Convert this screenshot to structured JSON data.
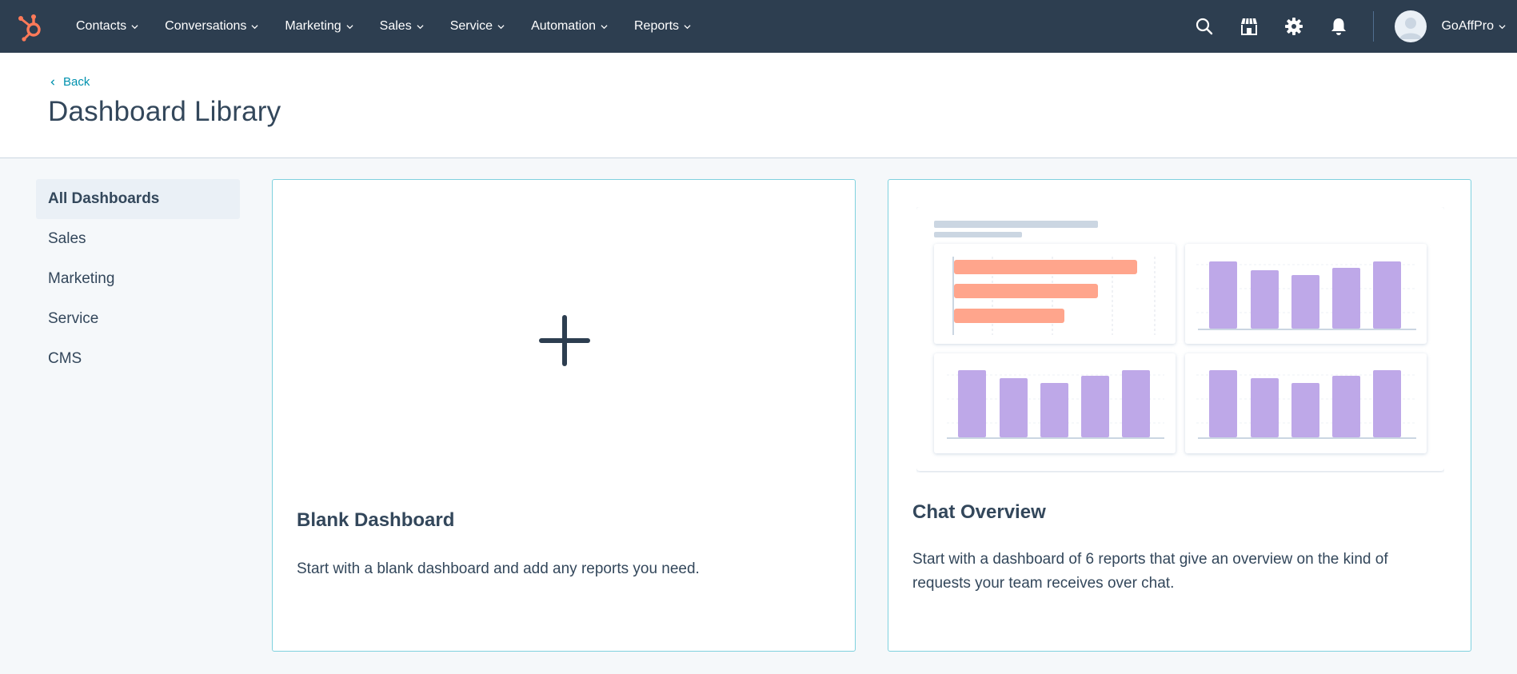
{
  "nav": {
    "items": [
      {
        "label": "Contacts"
      },
      {
        "label": "Conversations"
      },
      {
        "label": "Marketing"
      },
      {
        "label": "Sales"
      },
      {
        "label": "Service"
      },
      {
        "label": "Automation"
      },
      {
        "label": "Reports"
      }
    ],
    "account_name": "GoAffPro",
    "brand_color": "#ff7a59",
    "bar_color": "#2d3e50",
    "icons": [
      "search-icon",
      "marketplace-icon",
      "settings-icon",
      "notifications-icon"
    ]
  },
  "header": {
    "back_label": "Back",
    "title": "Dashboard Library"
  },
  "sidebar": {
    "items": [
      {
        "label": "All Dashboards",
        "active": true
      },
      {
        "label": "Sales"
      },
      {
        "label": "Marketing"
      },
      {
        "label": "Service"
      },
      {
        "label": "CMS"
      }
    ]
  },
  "cards": [
    {
      "title": "Blank Dashboard",
      "description": "Start with a blank dashboard and add any reports you need.",
      "icon": "plus-icon"
    },
    {
      "title": "Chat Overview",
      "description": "Start with a dashboard of 6 reports that give an overview on the kind of requests your team receives over chat.",
      "preview_colors": {
        "horizontal_bars": "#ffa58c",
        "vertical_bars": "#bea8e8"
      }
    }
  ]
}
